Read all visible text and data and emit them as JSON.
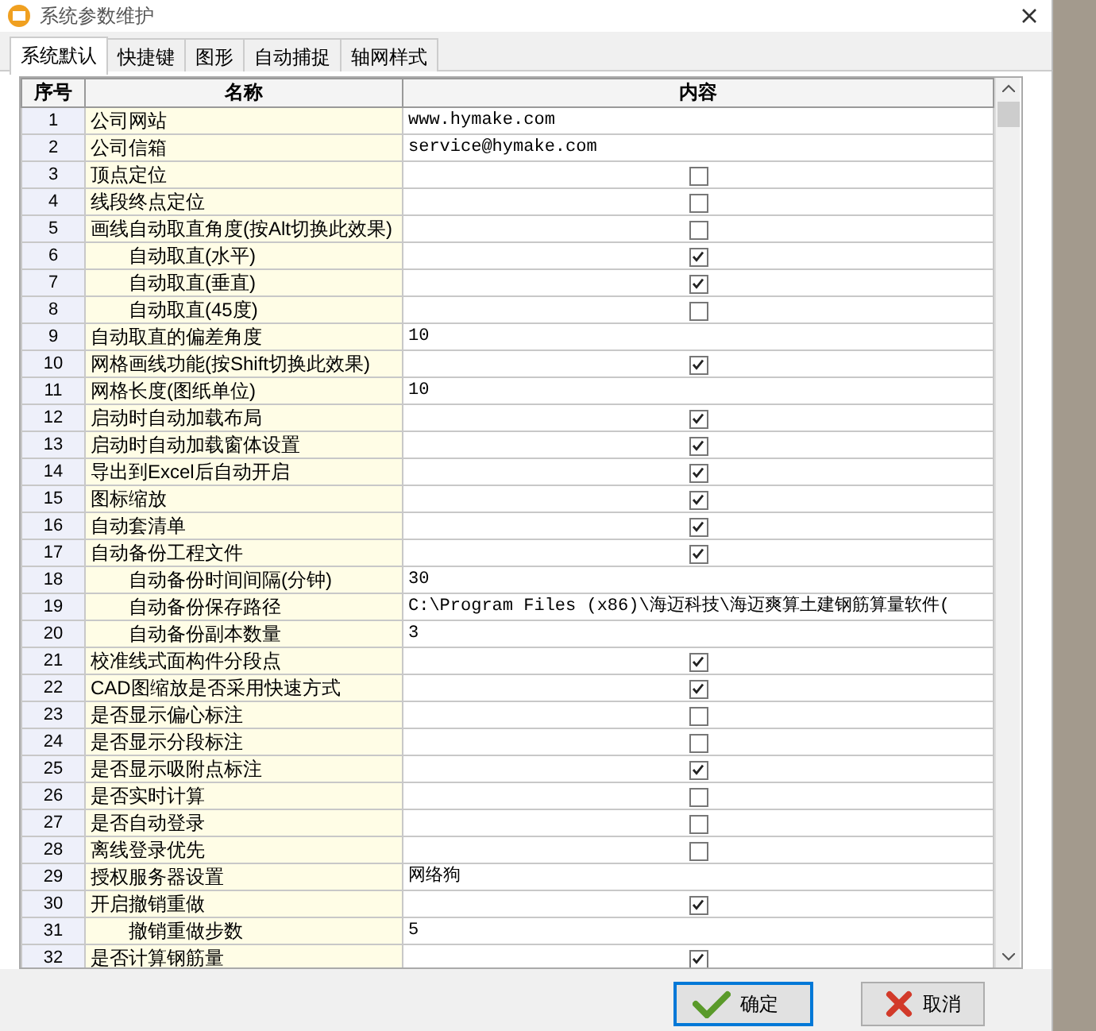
{
  "window": {
    "title": "系统参数维护"
  },
  "tabs": [
    {
      "label": "系统默认",
      "selected": true
    },
    {
      "label": "快捷键",
      "selected": false
    },
    {
      "label": "图形",
      "selected": false
    },
    {
      "label": "自动捕捉",
      "selected": false
    },
    {
      "label": "轴网样式",
      "selected": false
    }
  ],
  "table": {
    "columns": [
      "序号",
      "名称",
      "内容"
    ],
    "rows": [
      {
        "no": "1",
        "name": "公司网站",
        "kind": "text",
        "value": "www.hymake.com"
      },
      {
        "no": "2",
        "name": "公司信箱",
        "kind": "text",
        "value": "service@hymake.com"
      },
      {
        "no": "3",
        "name": "顶点定位",
        "kind": "checkbox",
        "checked": false
      },
      {
        "no": "4",
        "name": "线段终点定位",
        "kind": "checkbox",
        "checked": false
      },
      {
        "no": "5",
        "name": "画线自动取直角度(按Alt切换此效果)",
        "kind": "checkbox",
        "checked": false,
        "children": [
          {
            "no": "6",
            "name": "自动取直(水平)",
            "kind": "checkbox",
            "checked": true
          },
          {
            "no": "7",
            "name": "自动取直(垂直)",
            "kind": "checkbox",
            "checked": true
          },
          {
            "no": "8",
            "name": "自动取直(45度)",
            "kind": "checkbox",
            "checked": false
          }
        ]
      },
      {
        "no": "9",
        "name": "自动取直的偏差角度",
        "kind": "text",
        "value": "10"
      },
      {
        "no": "10",
        "name": "网格画线功能(按Shift切换此效果)",
        "kind": "checkbox",
        "checked": true
      },
      {
        "no": "11",
        "name": "网格长度(图纸单位)",
        "kind": "text",
        "value": "10"
      },
      {
        "no": "12",
        "name": "启动时自动加载布局",
        "kind": "checkbox",
        "checked": true
      },
      {
        "no": "13",
        "name": "启动时自动加载窗体设置",
        "kind": "checkbox",
        "checked": true
      },
      {
        "no": "14",
        "name": "导出到Excel后自动开启",
        "kind": "checkbox",
        "checked": true
      },
      {
        "no": "15",
        "name": "图标缩放",
        "kind": "checkbox",
        "checked": true
      },
      {
        "no": "16",
        "name": "自动套清单",
        "kind": "checkbox",
        "checked": true
      },
      {
        "no": "17",
        "name": "自动备份工程文件",
        "kind": "checkbox",
        "checked": true,
        "children": [
          {
            "no": "18",
            "name": "自动备份时间间隔(分钟)",
            "kind": "text",
            "value": "30"
          },
          {
            "no": "19",
            "name": "自动备份保存路径",
            "kind": "text",
            "value": "C:\\Program Files (x86)\\海迈科技\\海迈爽算土建钢筋算量软件("
          },
          {
            "no": "20",
            "name": "自动备份副本数量",
            "kind": "text",
            "value": "3"
          }
        ]
      },
      {
        "no": "21",
        "name": "校准线式面构件分段点",
        "kind": "checkbox",
        "checked": true
      },
      {
        "no": "22",
        "name": "CAD图缩放是否采用快速方式",
        "kind": "checkbox",
        "checked": true
      },
      {
        "no": "23",
        "name": "是否显示偏心标注",
        "kind": "checkbox",
        "checked": false
      },
      {
        "no": "24",
        "name": "是否显示分段标注",
        "kind": "checkbox",
        "checked": false
      },
      {
        "no": "25",
        "name": "是否显示吸附点标注",
        "kind": "checkbox",
        "checked": true
      },
      {
        "no": "26",
        "name": "是否实时计算",
        "kind": "checkbox",
        "checked": false
      },
      {
        "no": "27",
        "name": "是否自动登录",
        "kind": "checkbox",
        "checked": false
      },
      {
        "no": "28",
        "name": "离线登录优先",
        "kind": "checkbox",
        "checked": false
      },
      {
        "no": "29",
        "name": "授权服务器设置",
        "kind": "text",
        "value": "网络狗"
      },
      {
        "no": "30",
        "name": "开启撤销重做",
        "kind": "checkbox",
        "checked": true,
        "children": [
          {
            "no": "31",
            "name": "撤销重做步数",
            "kind": "text",
            "value": "5"
          }
        ]
      },
      {
        "no": "32",
        "name": "是否计算钢筋量",
        "kind": "checkbox",
        "checked": true
      }
    ]
  },
  "buttons": [
    {
      "label": "确定",
      "kind": "ok"
    },
    {
      "label": "取消",
      "kind": "cancel"
    }
  ]
}
